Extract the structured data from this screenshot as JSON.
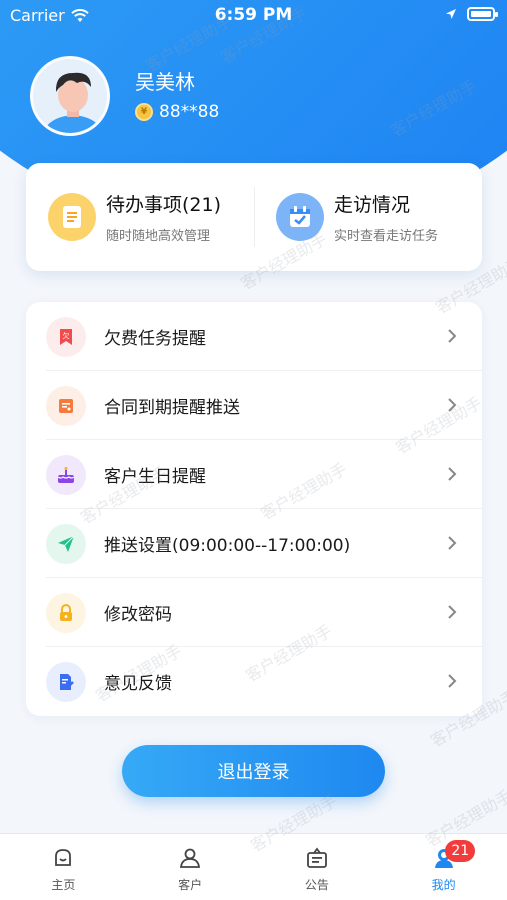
{
  "status_bar": {
    "carrier": "Carrier",
    "time": "6:59 PM"
  },
  "profile": {
    "name": "吴美林",
    "id": "88**88"
  },
  "quick_actions": [
    {
      "title": "待办事项(21)",
      "subtitle": "随时随地高效管理",
      "icon": "todo-list-icon",
      "color": "#f6a623"
    },
    {
      "title": "走访情况",
      "subtitle": "实时查看走访任务",
      "icon": "calendar-check-icon",
      "color": "#3a8df5"
    }
  ],
  "menu": [
    {
      "label": "欠费任务提醒",
      "icon": "arrears-tag-icon",
      "color": "#f24b4b"
    },
    {
      "label": "合同到期提醒推送",
      "icon": "contract-icon",
      "color": "#f57a3b"
    },
    {
      "label": "客户生日提醒",
      "icon": "birthday-cake-icon",
      "color": "#8a45e6"
    },
    {
      "label": "推送设置(09:00:00--17:00:00)",
      "icon": "paper-plane-icon",
      "color": "#22c08a"
    },
    {
      "label": "修改密码",
      "icon": "lock-icon",
      "color": "#f4b21f"
    },
    {
      "label": "意见反馈",
      "icon": "feedback-edit-icon",
      "color": "#3a6df0"
    }
  ],
  "logout_label": "退出登录",
  "tabs": [
    {
      "label": "主页",
      "icon": "home-icon",
      "active": false
    },
    {
      "label": "客户",
      "icon": "person-icon",
      "active": false
    },
    {
      "label": "公告",
      "icon": "notice-board-icon",
      "active": false
    },
    {
      "label": "我的",
      "icon": "mine-icon",
      "active": true,
      "badge": "21"
    }
  ],
  "watermark": "客户经理助手"
}
